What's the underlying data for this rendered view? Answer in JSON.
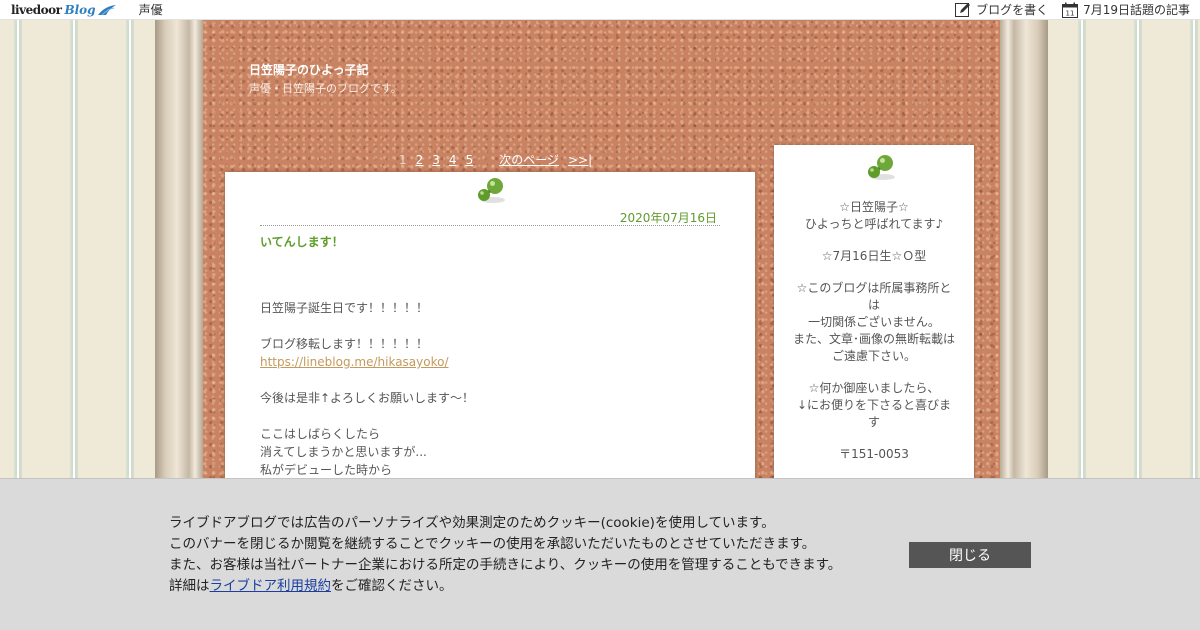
{
  "topbar": {
    "logo_word": "livedoor",
    "logo_blog": "Blog",
    "category_link": "声優",
    "write_blog": "ブログを書く",
    "topic_articles": "7月19日話題の記事",
    "calendar_day": "11",
    "icons": [
      "pencil-icon",
      "calendar-icon"
    ]
  },
  "header": {
    "title": "日笠陽子のひよっ子記",
    "description": "声優・日笠陽子のブログです。"
  },
  "pager": {
    "current": "1",
    "pages": [
      "2",
      "3",
      "4",
      "5"
    ],
    "next": "次のページ",
    "last": ">>|"
  },
  "post": {
    "date": "2020年07月16日",
    "title": "いてんします！",
    "lines": [
      "日笠陽子誕生日です！！！！！",
      "ブログ移転します！！！！！！",
      "https://lineblog.me/hikasayoko/",
      "今後は是非↑よろしくお願いします～！",
      "ここはしばらくしたら",
      "消えてしまうかと思いますが...",
      "私がデビューした時から"
    ]
  },
  "sidebar": {
    "lines": [
      "☆日笠陽子☆",
      "ひよっちと呼ばれてます♪",
      "☆7月16日生☆Ｏ型",
      "☆このブログは所属事務所とは",
      "一切関係ございません。",
      "また、文章･画像の無断転載は",
      "ご遠慮下さい。",
      "☆何か御座いましたら、",
      "↓にお便りを下さると喜びます",
      "〒151-0053"
    ]
  },
  "cookie": {
    "line1": "ライブドアブログでは広告のパーソナライズや効果測定のためクッキー(cookie)を使用しています。",
    "line2": "このバナーを閉じるか閲覧を継続することでクッキーの使用を承認いただいたものとさせていただきます。",
    "line3": "また、お客様は当社パートナー企業における所定の手続きにより、クッキーの使用を管理することもできます。",
    "line4_prefix": "詳細は",
    "line4_link": "ライブドア利用規約",
    "line4_suffix": "をご確認ください。",
    "close_label": "閉じる"
  },
  "colors": {
    "accent_green": "#5f9c2b",
    "cork": "#c98362",
    "link_tan": "#c49a5c",
    "close_button": "#555555"
  }
}
